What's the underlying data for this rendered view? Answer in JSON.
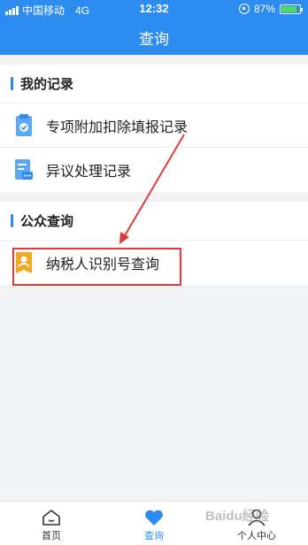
{
  "status": {
    "carrier": "中国移动",
    "network": "4G",
    "time": "12:32",
    "battery": "87%"
  },
  "header": {
    "title": "查询"
  },
  "records": {
    "heading": "我的记录",
    "items": [
      {
        "label": "专项附加扣除填报记录",
        "icon": "clipboard-check-icon"
      },
      {
        "label": "异议处理记录",
        "icon": "document-chat-icon"
      }
    ]
  },
  "public": {
    "heading": "公众查询",
    "items": [
      {
        "label": "纳税人识别号查询",
        "icon": "id-badge-icon"
      }
    ]
  },
  "tabs": [
    {
      "label": "首页",
      "icon": "home-icon",
      "active": false
    },
    {
      "label": "查询",
      "icon": "heart-icon",
      "active": true
    },
    {
      "label": "个人中心",
      "icon": "person-icon",
      "active": false
    }
  ],
  "watermark": "Baidu经验",
  "colors": {
    "primary": "#2d8cf0",
    "annotation": "#e23a3a",
    "icon_orange": "#f5a623"
  }
}
